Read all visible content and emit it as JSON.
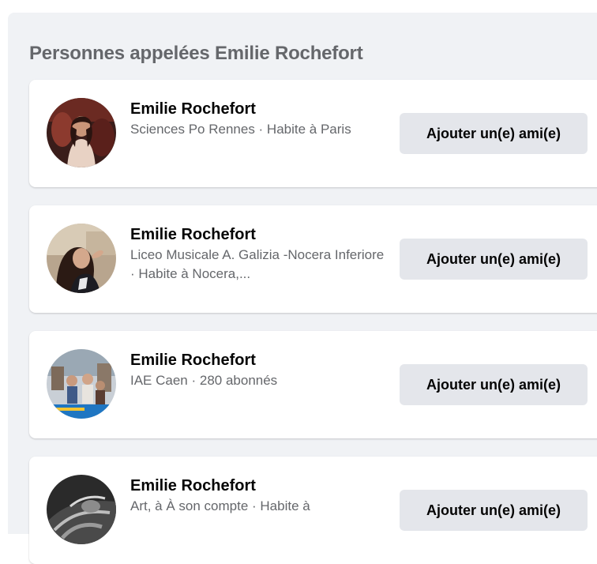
{
  "section": {
    "title": "Personnes appelées Emilie Rochefort"
  },
  "results": [
    {
      "name": "Emilie Rochefort",
      "description": "Sciences Po Rennes · Habite à Paris",
      "button_label": "Ajouter un(e) ami(e)"
    },
    {
      "name": "Emilie Rochefort",
      "description": "Liceo Musicale A. Galizia -Nocera Inferiore · Habite à Nocera,...",
      "button_label": "Ajouter un(e) ami(e)"
    },
    {
      "name": "Emilie Rochefort",
      "description": "IAE Caen · 280 abonnés",
      "button_label": "Ajouter un(e) ami(e)"
    },
    {
      "name": "Emilie Rochefort",
      "description": "Art, à À son compte · Habite à",
      "button_label": "Ajouter un(e) ami(e)"
    }
  ],
  "colors": {
    "panel_background": "#f0f2f5",
    "card_background": "#ffffff",
    "button_background": "#e4e6eb",
    "primary_text": "#050505",
    "secondary_text": "#65676b"
  }
}
